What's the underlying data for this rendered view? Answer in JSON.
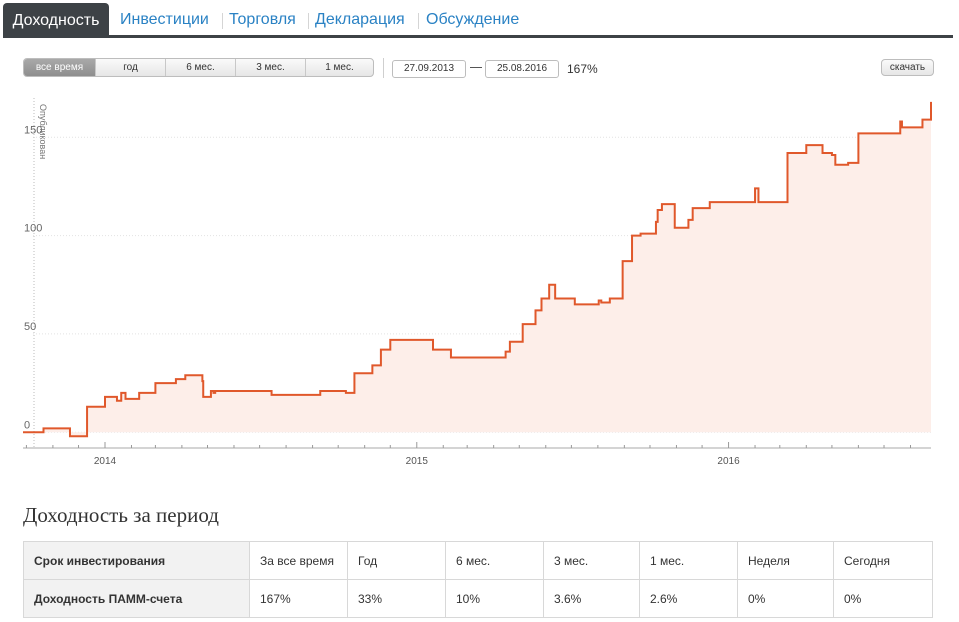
{
  "tabs": {
    "active": "Доходность",
    "items": [
      "Инвестиции",
      "Торговля",
      "Декларация",
      "Обсуждение"
    ]
  },
  "toolbar": {
    "ranges": [
      "все время",
      "год",
      "6 мес.",
      "3 мес.",
      "1 мес."
    ],
    "active_range": "все время",
    "date_from": "27.09.2013",
    "date_to": "25.08.2016",
    "change": "167%",
    "download_label": "скачать"
  },
  "chart_data": {
    "type": "area",
    "ylabel": "Опубликован",
    "yticks": [
      0,
      50,
      100,
      150
    ],
    "ylim": [
      -8,
      172
    ],
    "xlim": [
      "2013-09-27",
      "2016-08-25"
    ],
    "xticks": [
      "2014",
      "2015",
      "2016"
    ],
    "colors": {
      "line": "#e0582b",
      "fill": "#fdeee9"
    },
    "grid": true,
    "x": [
      "2013-09-27",
      "2013-10-20",
      "2013-10-21",
      "2013-11-20",
      "2013-11-21",
      "2013-12-10",
      "2013-12-11",
      "2014-01-01",
      "2014-01-15",
      "2014-01-20",
      "2014-01-25",
      "2014-02-10",
      "2014-03-01",
      "2014-03-25",
      "2014-04-05",
      "2014-04-25",
      "2014-04-26",
      "2014-05-05",
      "2014-05-08",
      "2014-05-10",
      "2014-05-25",
      "2014-07-15",
      "2014-08-20",
      "2014-09-10",
      "2014-10-10",
      "2014-10-20",
      "2014-11-10",
      "2014-11-20",
      "2014-12-01",
      "2015-01-01",
      "2015-01-20",
      "2015-02-10",
      "2015-04-15",
      "2015-04-20",
      "2015-05-05",
      "2015-05-20",
      "2015-05-27",
      "2015-06-05",
      "2015-06-12",
      "2015-07-05",
      "2015-08-02",
      "2015-08-05",
      "2015-08-15",
      "2015-08-25",
      "2015-08-30",
      "2015-09-10",
      "2015-09-20",
      "2015-10-08",
      "2015-10-10",
      "2015-10-15",
      "2015-10-25",
      "2015-10-30",
      "2015-11-15",
      "2015-11-20",
      "2015-12-10",
      "2016-01-20",
      "2016-02-01",
      "2016-02-05",
      "2016-03-10",
      "2016-04-01",
      "2016-04-20",
      "2016-05-01",
      "2016-05-05",
      "2016-05-20",
      "2016-06-01",
      "2016-07-20",
      "2016-07-22",
      "2016-08-15",
      "2016-08-25"
    ],
    "y": [
      0,
      0,
      2,
      2,
      -2,
      -2,
      13,
      18,
      16,
      20,
      17,
      20,
      25,
      27,
      29,
      26,
      18,
      21,
      20,
      21,
      21,
      19,
      19,
      21,
      20,
      30,
      34,
      42,
      47,
      47,
      42,
      38,
      41,
      46,
      55,
      62,
      68,
      75,
      68,
      65,
      67,
      66,
      68,
      68,
      87,
      100,
      101,
      107,
      113,
      116,
      116,
      104,
      108,
      114,
      117,
      117,
      124,
      117,
      142,
      146,
      142,
      141,
      136,
      137,
      152,
      158,
      155,
      159,
      168
    ]
  },
  "period": {
    "title": "Доходность за период",
    "headers": [
      "Срок инвестирования",
      "За все время",
      "Год",
      "6 мес.",
      "3 мес.",
      "1 мес.",
      "Неделя",
      "Сегодня"
    ],
    "values": [
      "Доходность ПАММ-счета",
      "167%",
      "33%",
      "10%",
      "3.6%",
      "2.6%",
      "0%",
      "0%"
    ]
  }
}
